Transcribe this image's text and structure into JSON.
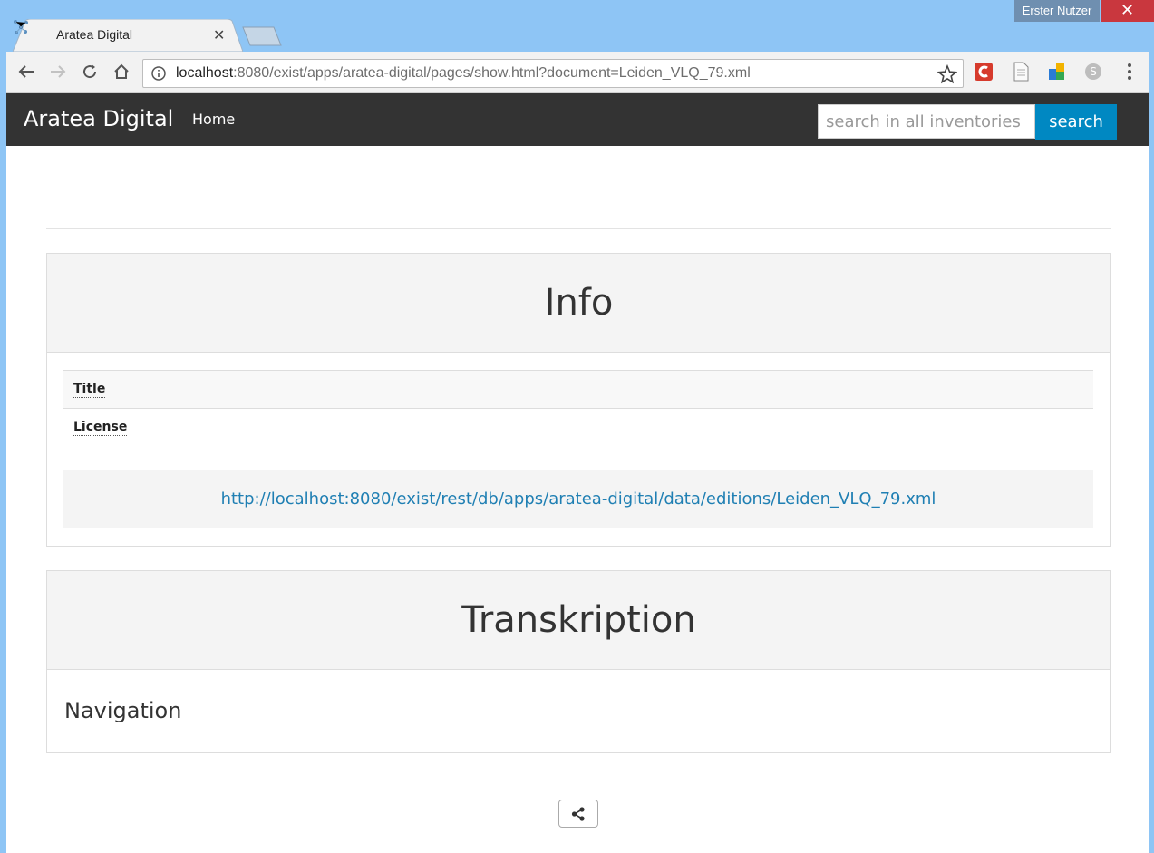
{
  "window": {
    "user_badge": "Erster Nutzer",
    "close_glyph": "✕"
  },
  "tab": {
    "title": "Aratea Digital",
    "close_glyph": "✕"
  },
  "address_bar": {
    "host": "localhost",
    "path": ":8080/exist/apps/aratea-digital/pages/show.html?document=Leiden_VLQ_79.xml"
  },
  "navbar": {
    "brand": "Aratea Digital",
    "home": "Home",
    "search_placeholder": "search in all inventories",
    "search_button": "search"
  },
  "info_panel": {
    "title": "Info",
    "rows": [
      {
        "label": "Title"
      },
      {
        "label": "License"
      }
    ],
    "source_url": "http://localhost:8080/exist/rest/db/apps/aratea-digital/data/editions/Leiden_VLQ_79.xml"
  },
  "transcription_panel": {
    "title": "Transkription",
    "navigation": "Navigation"
  },
  "colors": {
    "navbar_bg": "#333333",
    "search_button_bg": "#0088c2",
    "link": "#1f7fb3",
    "titlebar": "#8ec5f5"
  },
  "icons": [
    "back-icon",
    "forward-icon",
    "reload-icon",
    "home-icon",
    "info-icon",
    "star-icon",
    "extension-c-icon",
    "document-icon",
    "extension-puzzle-icon",
    "skype-icon",
    "menu-dots-icon",
    "share-icon"
  ]
}
